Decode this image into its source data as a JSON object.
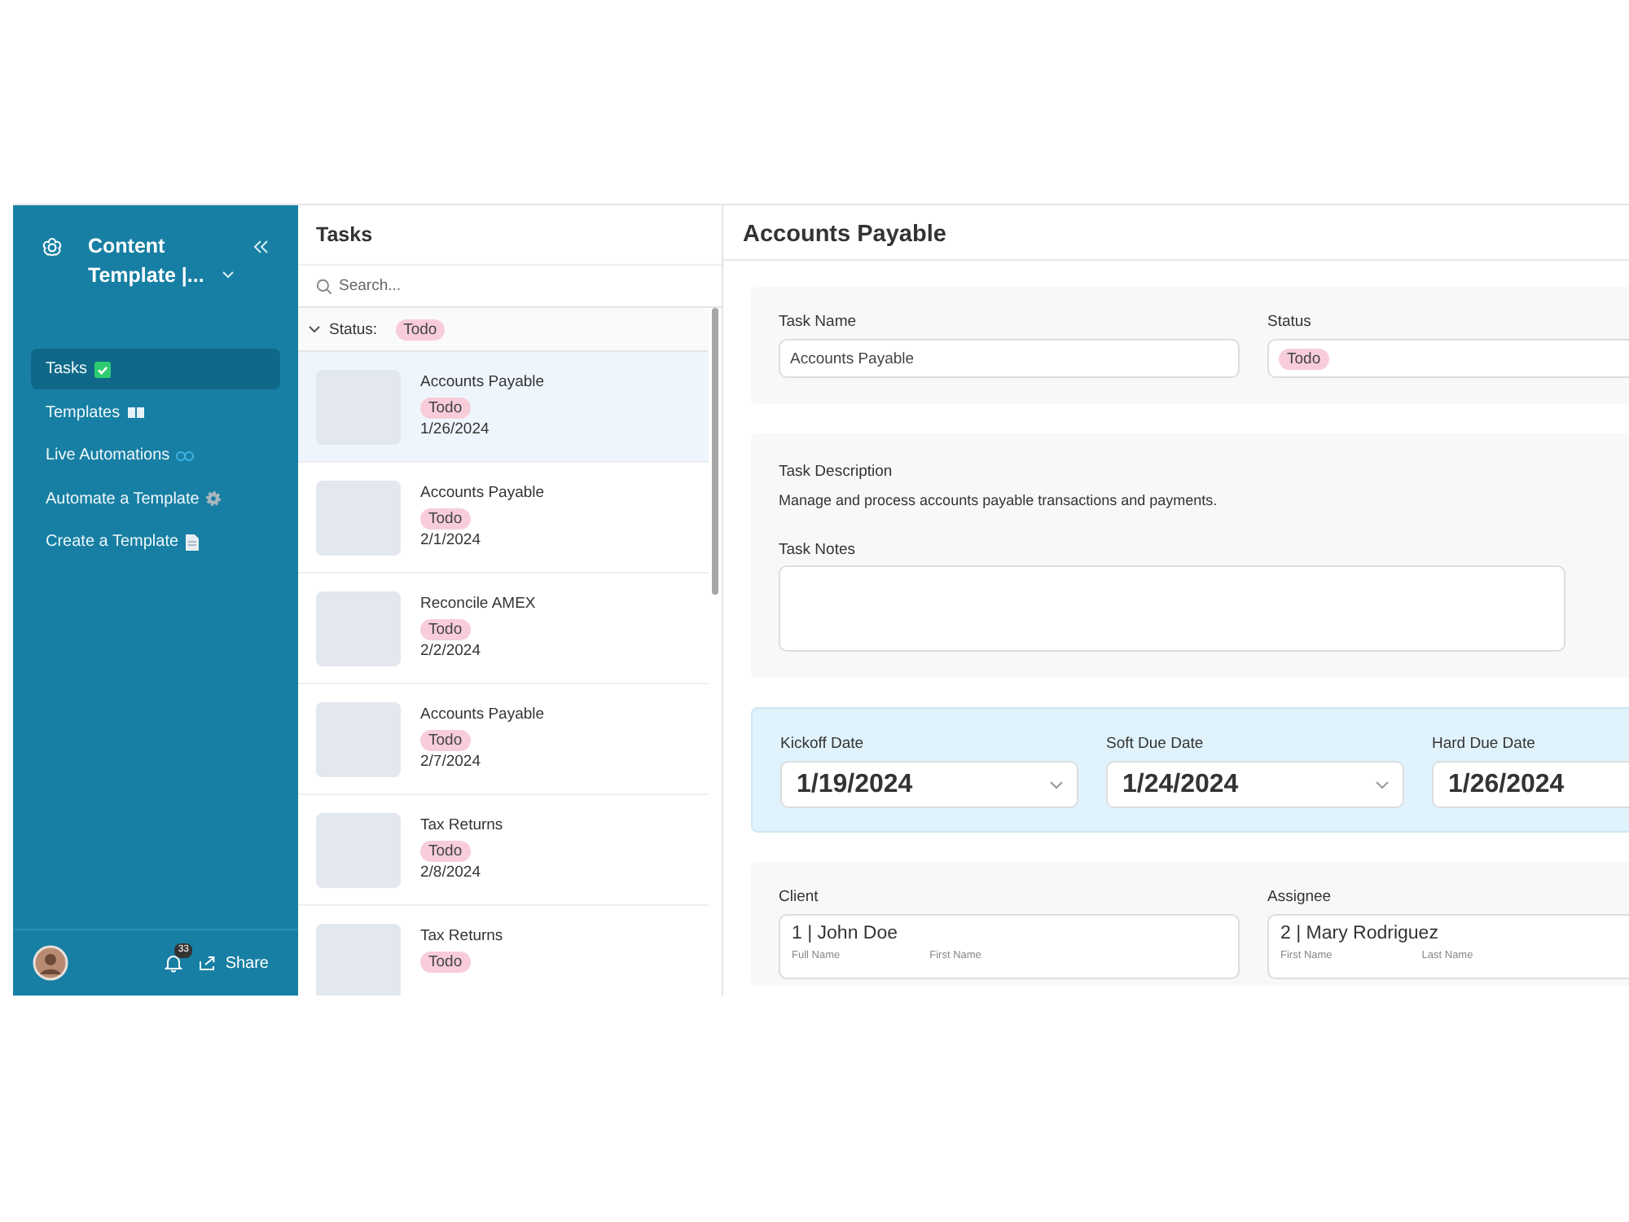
{
  "sidebar": {
    "title": "Content Template |...",
    "items": [
      {
        "label": "Tasks",
        "kind": "check",
        "selected": true
      },
      {
        "label": "Templates",
        "kind": "book",
        "selected": false
      },
      {
        "label": "Live Automations",
        "kind": "link",
        "selected": false
      },
      {
        "label": "Automate a Template",
        "kind": "gear",
        "selected": false
      },
      {
        "label": "Create a Template",
        "kind": "doc",
        "selected": false
      }
    ],
    "notification_count": "33",
    "share": "Share"
  },
  "task_list": {
    "title": "Tasks",
    "search": {
      "placeholder": "Search..."
    },
    "group": {
      "label": "Status:",
      "tag": "Todo",
      "expanded": true
    },
    "items": [
      {
        "title": "Accounts Payable",
        "tag": "Todo",
        "date": "1/26/2024",
        "selected": true
      },
      {
        "title": "Accounts Payable",
        "tag": "Todo",
        "date": "2/1/2024",
        "selected": false
      },
      {
        "title": "Reconcile AMEX",
        "tag": "Todo",
        "date": "2/2/2024",
        "selected": false
      },
      {
        "title": "Accounts Payable",
        "tag": "Todo",
        "date": "2/7/2024",
        "selected": false
      },
      {
        "title": "Tax Returns",
        "tag": "Todo",
        "date": "2/8/2024",
        "selected": false
      },
      {
        "title": "Tax Returns",
        "tag": "Todo",
        "selected": false
      }
    ]
  },
  "detail": {
    "title": "Accounts Payable",
    "task_name": {
      "label": "Task Name",
      "value": "Accounts Payable"
    },
    "status": {
      "label": "Status",
      "tag": "Todo"
    },
    "description": {
      "label": "Task Description",
      "text": "Manage and process accounts payable transactions and payments."
    },
    "notes": {
      "label": "Task Notes"
    },
    "dates": [
      {
        "label": "Kickoff Date",
        "value": "1/19/2024"
      },
      {
        "label": "Soft Due Date",
        "value": "1/24/2024"
      },
      {
        "label": "Hard Due Date",
        "value": "1/26/2024"
      }
    ],
    "people": [
      {
        "label": "Client",
        "value": "1 | John Doe",
        "subfields": [
          "Full Name",
          "First Name"
        ]
      },
      {
        "label": "Assignee",
        "value": "2 | Mary Rodriguez",
        "subfields": [
          "First Name",
          "Last Name"
        ]
      }
    ]
  }
}
